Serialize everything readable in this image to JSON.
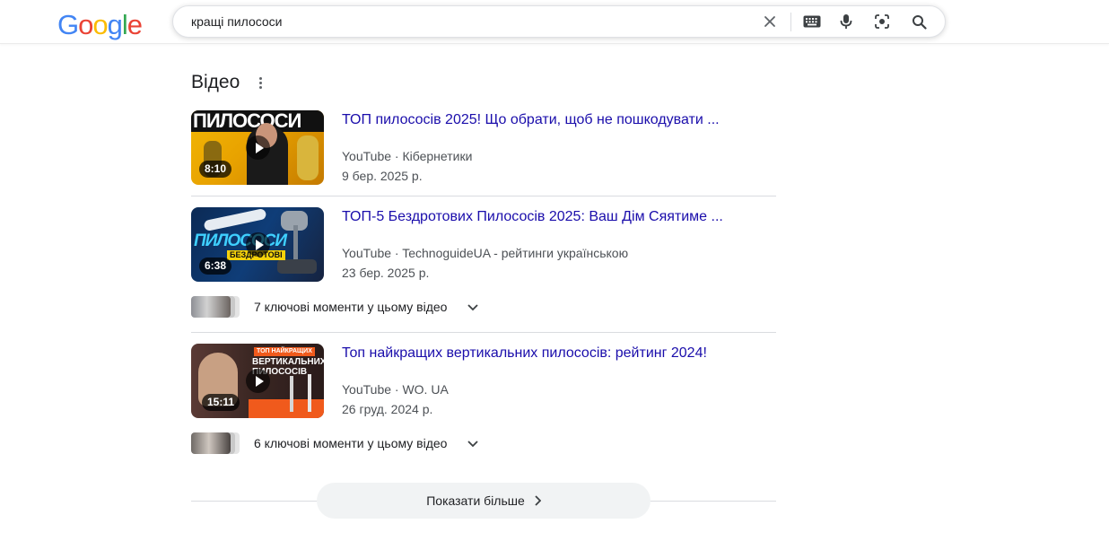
{
  "logo": {
    "text": "Google",
    "letters": [
      "G",
      "o",
      "o",
      "g",
      "l",
      "e"
    ],
    "colors": [
      "#4285f4",
      "#ea4335",
      "#fbbc05",
      "#4285f4",
      "#34a853",
      "#ea4335"
    ]
  },
  "search": {
    "query": "кращі пилососи"
  },
  "icons": [
    "close-icon",
    "keyboard-icon",
    "microphone-icon",
    "lens-icon",
    "search-icon",
    "more-vert-icon",
    "play-icon",
    "chevron-down-icon",
    "chevron-right-icon"
  ],
  "section": {
    "title": "Відео"
  },
  "videos": [
    {
      "title": "ТОП пилососів 2025! Що обрати, щоб не пошкодувати ...",
      "source": "YouTube · Кібернетики",
      "date": "9 бер. 2025 р.",
      "duration": "8:10",
      "thumb_text": "ПИЛОСОСИ"
    },
    {
      "title": "ТОП-5 Бездротових Пилососів 2025: Ваш Дім Сяятиме ...",
      "source": "YouTube · TechnoguideUA - рейтинги українською",
      "date": "23 бер. 2025 р.",
      "duration": "6:38",
      "thumb_text": "ПИЛОСОСИ",
      "thumb_subtext": "БЕЗДРОТОВІ",
      "key_moments": "7 ключові моменти у цьому відео"
    },
    {
      "title": "Топ найкращих вертикальних пилососів: рейтинг 2024!",
      "source": "YouTube · WO. UA",
      "date": "26 груд. 2024 р.",
      "duration": "15:11",
      "thumb_badge": "ТОП НАЙКРАЩИХ",
      "thumb_text": "ВЕРТИКАЛЬНИХ ПИЛОСОСІВ",
      "key_moments": "6 ключові моменти у цьому відео"
    }
  ],
  "show_more": "Показати більше",
  "colors": {
    "link": "#1a0dab",
    "meta": "#4d5156",
    "divider": "#dadce0",
    "button_bg": "#f1f3f4"
  }
}
